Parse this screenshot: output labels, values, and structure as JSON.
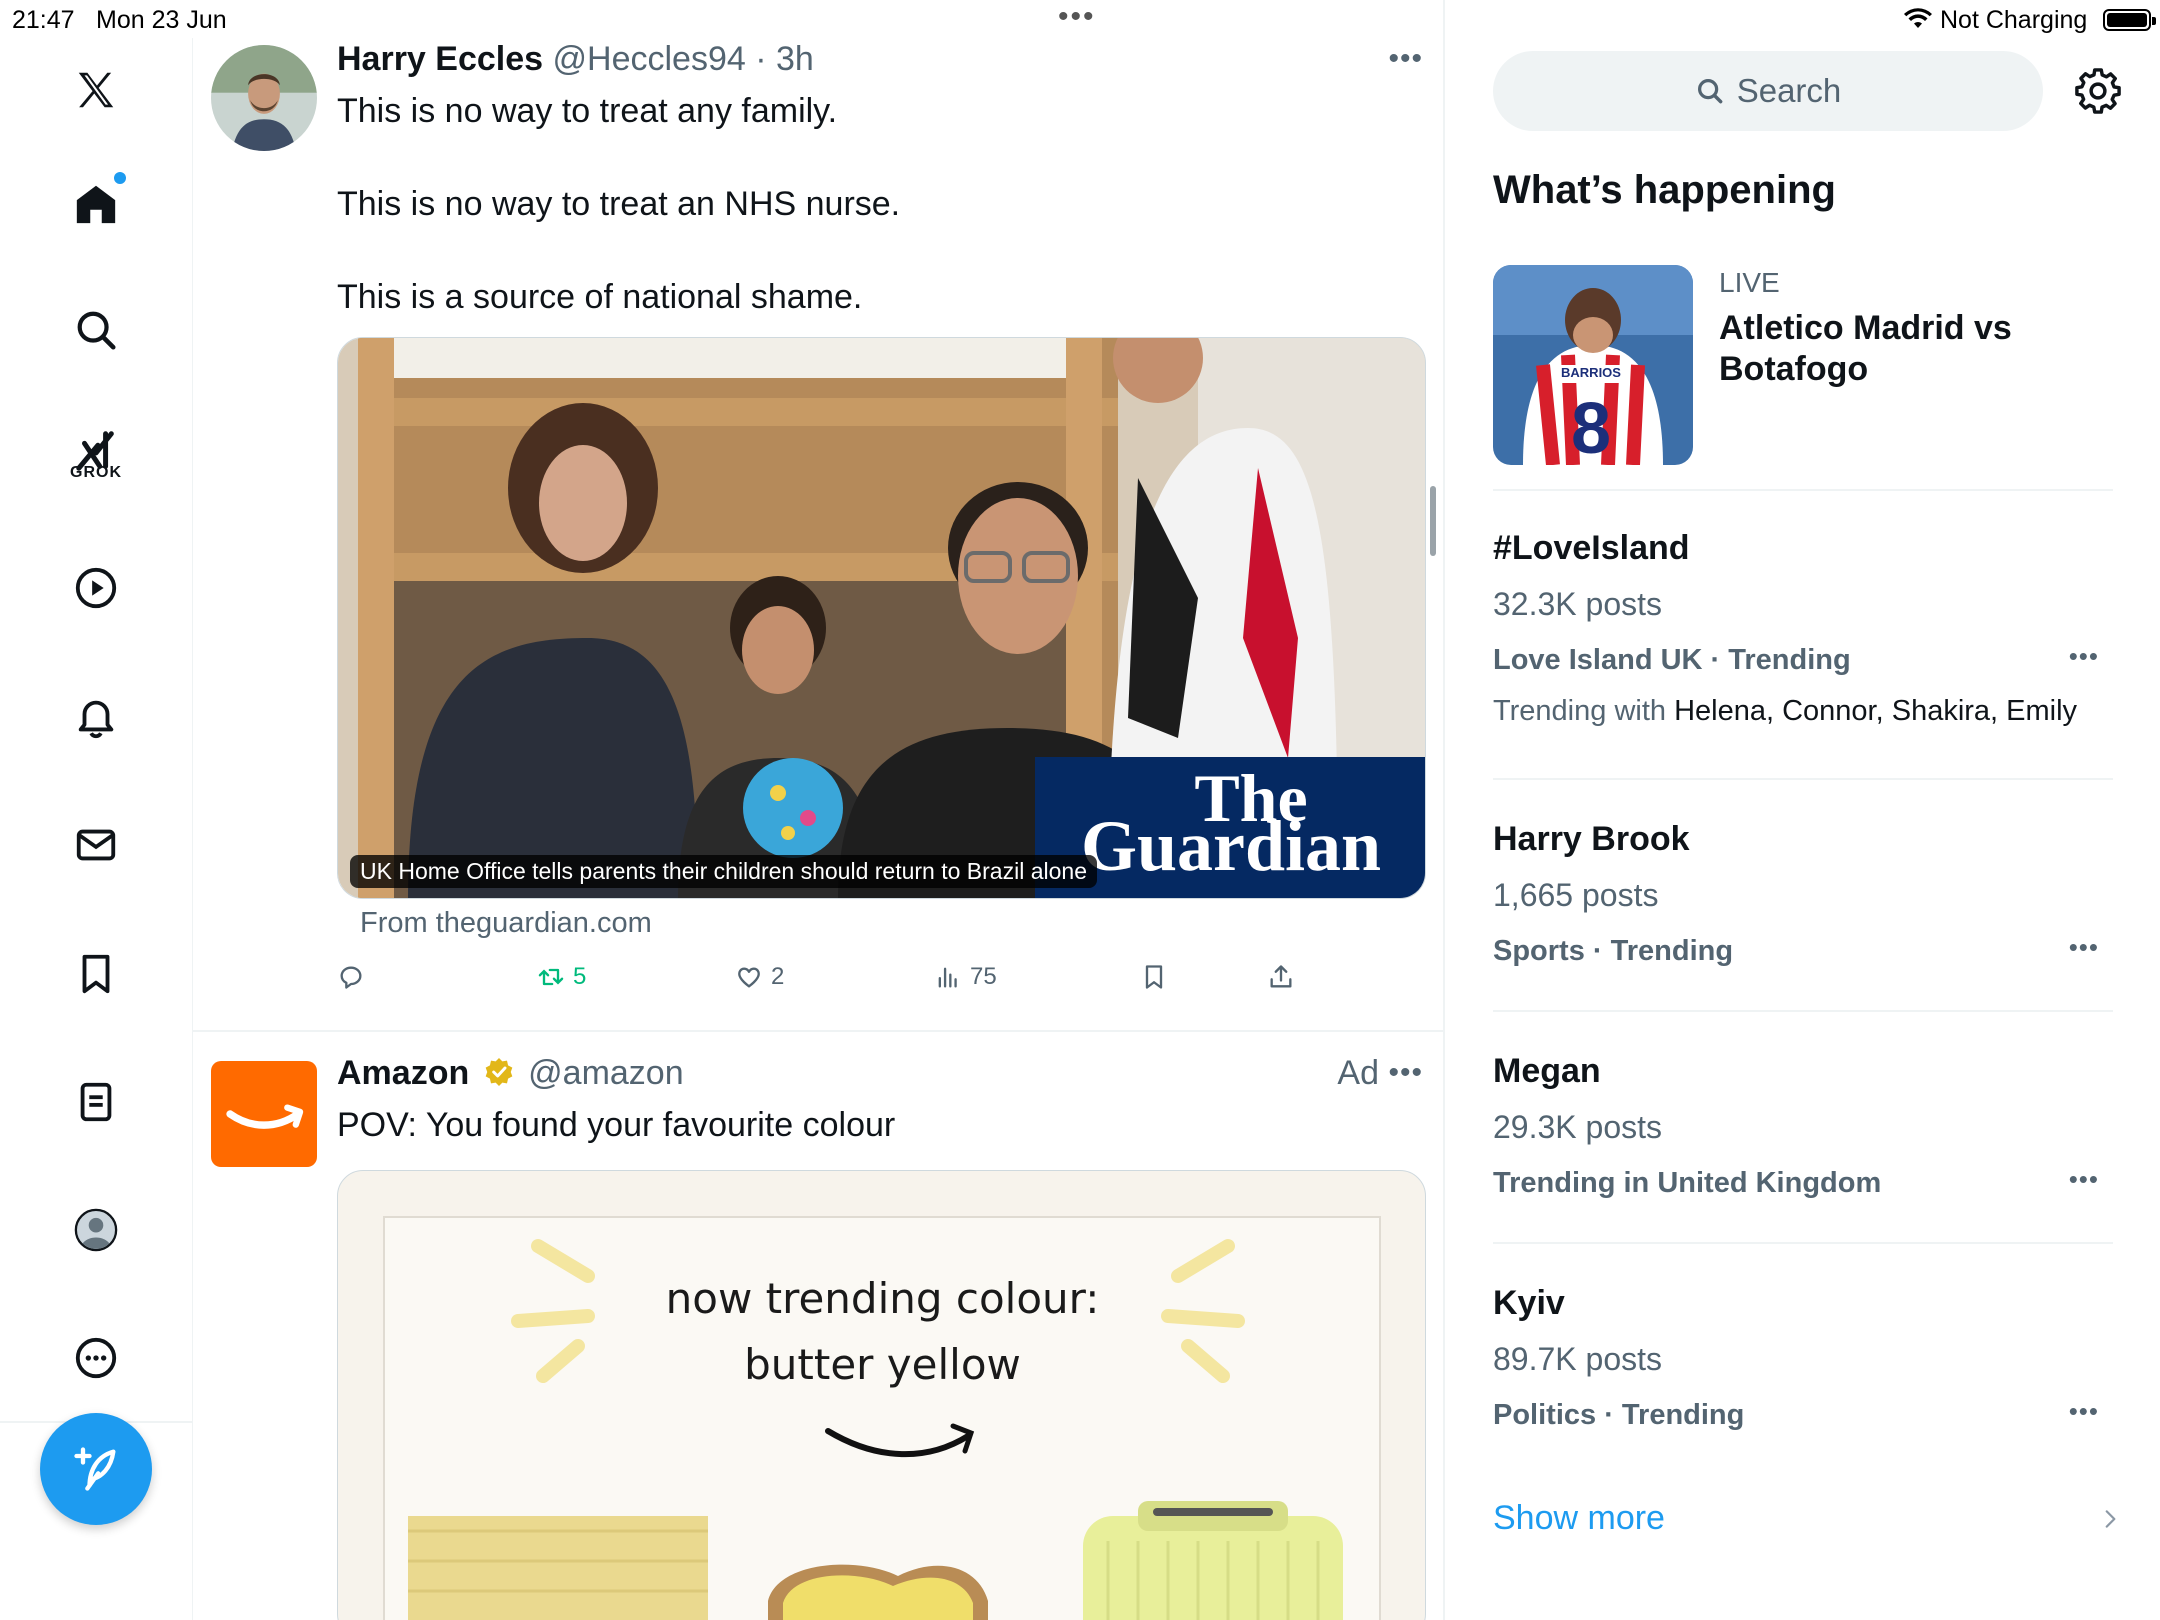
{
  "status": {
    "time": "21:47",
    "date": "Mon 23 Jun",
    "charging": "Not Charging"
  },
  "nav": {
    "grok_label": "GROK",
    "items": [
      "x-logo",
      "home-icon",
      "search-icon",
      "grok-icon",
      "video-icon",
      "notifications-icon",
      "messages-icon",
      "bookmarks-icon",
      "lists-icon",
      "profile-icon",
      "more-icon"
    ]
  },
  "tweets": [
    {
      "name": "Harry Eccles",
      "handle": "@Heccles94",
      "time": "3h",
      "lines": [
        "This is no way to treat any family.",
        "This is no way to treat an NHS nurse.",
        "This is a source of national shame."
      ],
      "card_caption": "UK Home Office tells parents their children should return to Brazil alone",
      "card_logo_line1": "The",
      "card_logo_line2": "Guardian",
      "from": "From theguardian.com",
      "replies": "",
      "retweets": "5",
      "likes": "2",
      "views": "75"
    },
    {
      "name": "Amazon",
      "handle": "@amazon",
      "ad": "Ad",
      "text": "POV: You found your favourite colour",
      "image_line1": "now trending colour:",
      "image_line2": "butter yellow"
    }
  ],
  "sidebar": {
    "search_placeholder": "Search",
    "title": "What’s happening",
    "live": {
      "tag": "LIVE",
      "title": "Atletico Madrid vs Botafogo",
      "shirt_name": "BARRIOS",
      "shirt_number": "8"
    },
    "trends": [
      {
        "name": "#LoveIsland",
        "posts": "32.3K posts",
        "meta": "Love Island UK · Trending",
        "with_label": "Trending with",
        "with_names": "Helena, Connor, Shakira, Emily"
      },
      {
        "name": "Harry Brook",
        "posts": "1,665 posts",
        "meta": "Sports · Trending"
      },
      {
        "name": "Megan",
        "posts": "29.3K posts",
        "meta": "Trending in United Kingdom"
      },
      {
        "name": "Kyiv",
        "posts": "89.7K posts",
        "meta": "Politics · Trending"
      }
    ],
    "show_more": "Show more"
  },
  "colors": {
    "accent": "#1d9bf0",
    "retweet": "#00ba7c",
    "muted_text": "#536471",
    "guardian_blue": "#052962",
    "amazon_orange": "#ff6a00"
  }
}
